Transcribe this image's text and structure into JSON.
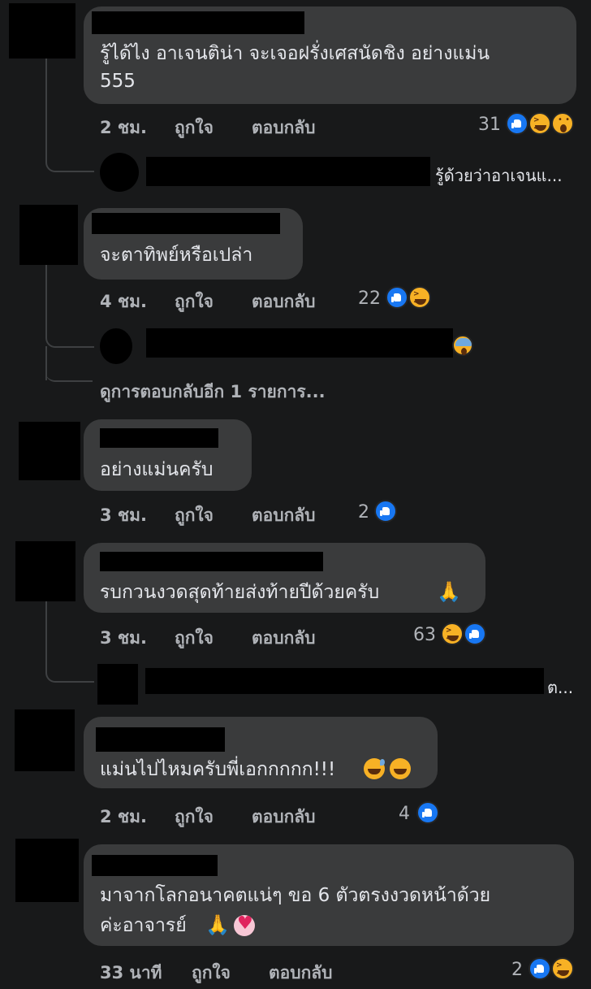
{
  "comments": [
    {
      "text_lines": [
        "รู้ได้ไง อาเจนติน่า จะเจอฝรั่งเศสนัดชิง อย่างแม่น",
        "555"
      ],
      "time": "2 ชม.",
      "like_label": "ถูกใจ",
      "reply_label": "ตอบกลับ",
      "reaction_count": "31",
      "reactions": [
        "like-icon",
        "haha-icon",
        "wow-icon"
      ],
      "replies": [
        {
          "text": "รู้ด้วยว่าอาเจนแ..."
        }
      ]
    },
    {
      "text_lines": [
        "จะตาทิพย์หรือเปล่า"
      ],
      "time": "4 ชม.",
      "like_label": "ถูกใจ",
      "reply_label": "ตอบกลับ",
      "reaction_count": "22",
      "reactions": [
        "like-icon",
        "haha-icon"
      ],
      "replies": [
        {
          "text": "",
          "reaction": "scream-icon"
        }
      ],
      "more_replies": "ดูการตอบกลับอีก 1 รายการ..."
    },
    {
      "text_lines": [
        "อย่างแม่นครับ"
      ],
      "time": "3 ชม.",
      "like_label": "ถูกใจ",
      "reply_label": "ตอบกลับ",
      "reaction_count": "2",
      "reactions": [
        "like-icon"
      ]
    },
    {
      "text_lines": [
        "รบกวนงวดสุดท้ายส่งท้ายปีด้วยครับ"
      ],
      "emoji": [
        "pray-icon"
      ],
      "time": "3 ชม.",
      "like_label": "ถูกใจ",
      "reply_label": "ตอบกลับ",
      "reaction_count": "63",
      "reactions": [
        "haha-icon",
        "like-icon"
      ],
      "replies": [
        {
          "text": "ต..."
        }
      ]
    },
    {
      "text_lines": [
        "แม่นไปไหมครับพี่เอกกกกก!!!"
      ],
      "emoji": [
        "grin-sweat-icon",
        "laugh-icon"
      ],
      "time": "2 ชม.",
      "like_label": "ถูกใจ",
      "reply_label": "ตอบกลับ",
      "reaction_count": "4",
      "reactions": [
        "like-icon"
      ]
    },
    {
      "text_lines": [
        "มาจากโลกอนาคตแน่ๆ ขอ 6 ตัวตรงงวดหน้าด้วย",
        "ค่ะอาจารย์"
      ],
      "emoji": [
        "pray-icon",
        "heart-icon"
      ],
      "time": "33 นาที",
      "like_label": "ถูกใจ",
      "reply_label": "ตอบกลับ",
      "reaction_count": "2",
      "reactions": [
        "like-icon",
        "haha-icon"
      ]
    }
  ],
  "colors": {
    "background": "#18191a",
    "bubble": "#3a3b3c",
    "text": "#e4e6eb",
    "meta": "#b0b3b8",
    "like": "#1877f2",
    "haha": "#f7b125",
    "redaction": "#000000"
  }
}
